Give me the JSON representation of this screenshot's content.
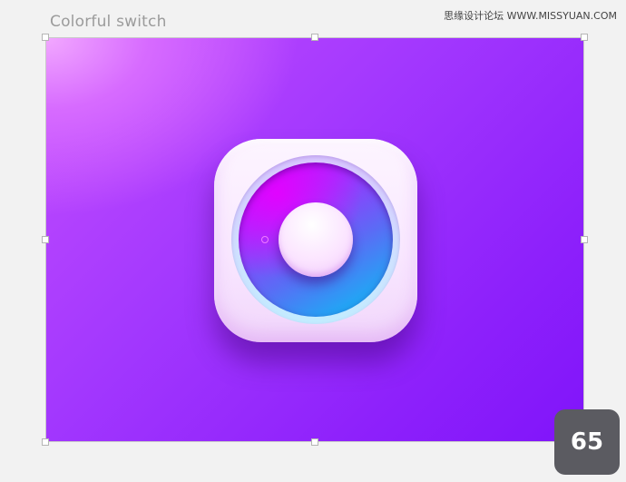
{
  "header": {
    "title": "Colorful switch",
    "watermark": "思缘设计论坛 WWW.MISSYUAN.COM"
  },
  "artboard": {
    "background_colors": [
      "#f2a8ff",
      "#c24cff",
      "#a338fe",
      "#8014fa"
    ],
    "icon": {
      "name": "knob-switch-icon",
      "tile_color": "#fbefff",
      "ring_colors": [
        "#d400ff",
        "#9c33ff",
        "#00c8f5"
      ],
      "indicator_color": "#e26bff"
    }
  },
  "badge": {
    "page_number": "65",
    "color": "#5b5b61"
  }
}
